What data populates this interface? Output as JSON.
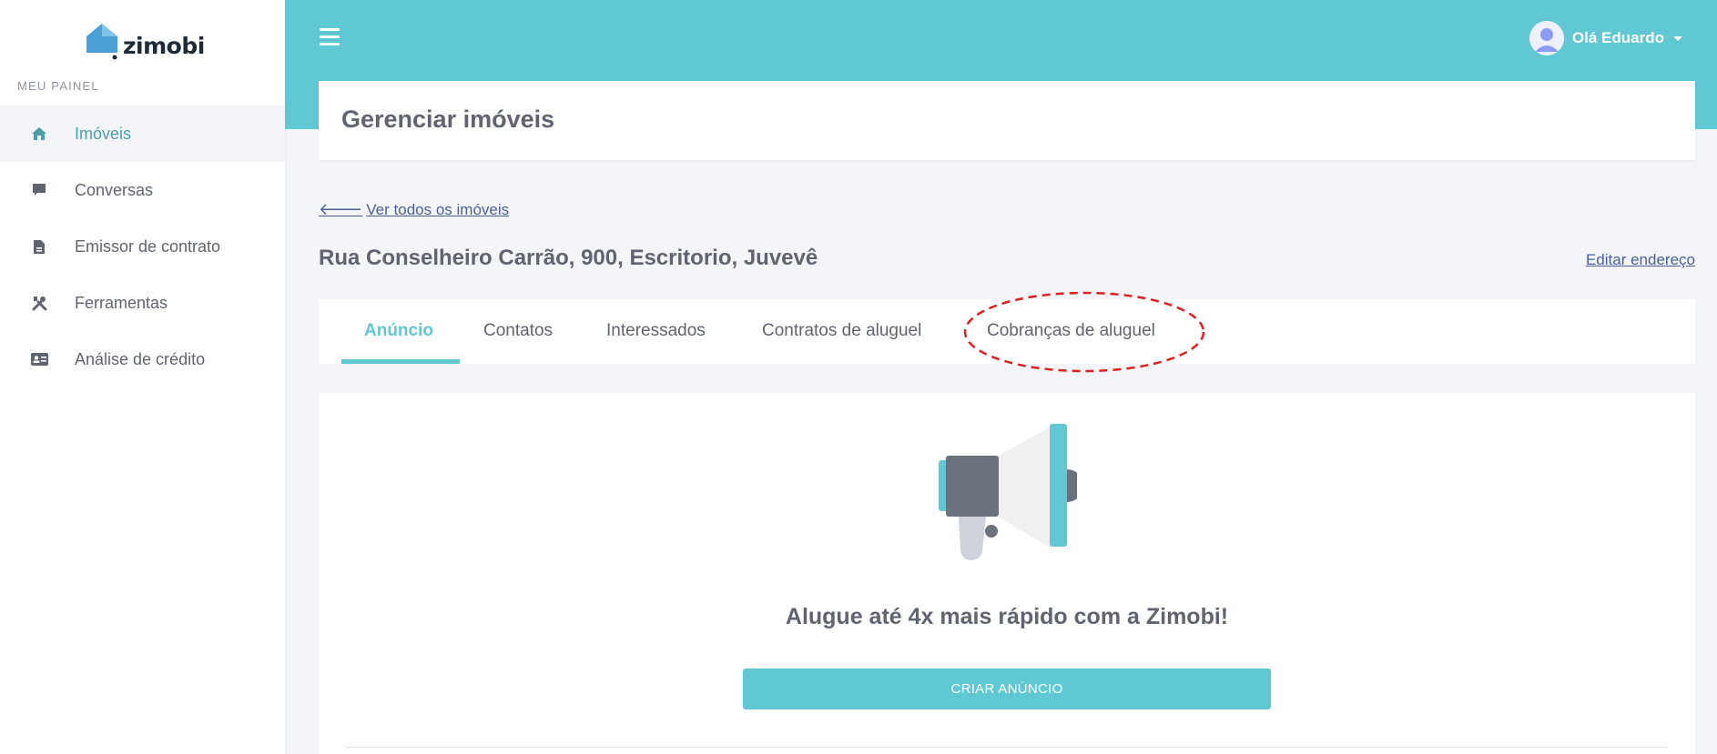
{
  "brand": {
    "name": "zimobi",
    "panel_label": "MEU PAINEL"
  },
  "sidebar": {
    "items": [
      {
        "label": "Imóveis",
        "icon": "home-icon",
        "active": true
      },
      {
        "label": "Conversas",
        "icon": "chat-icon",
        "active": false
      },
      {
        "label": "Emissor de contrato",
        "icon": "document-icon",
        "active": false
      },
      {
        "label": "Ferramentas",
        "icon": "tools-icon",
        "active": false
      },
      {
        "label": "Análise de crédito",
        "icon": "id-card-icon",
        "active": false
      }
    ]
  },
  "header": {
    "user_greeting": "Olá Eduardo"
  },
  "page": {
    "title": "Gerenciar imóveis",
    "back_link": "Ver todos os imóveis",
    "address": "Rua Conselheiro Carrão, 900, Escritorio, Juvevê",
    "edit_link": "Editar endereço"
  },
  "tabs": [
    {
      "label": "Anúncio",
      "active": true
    },
    {
      "label": "Contatos",
      "active": false
    },
    {
      "label": "Interessados",
      "active": false
    },
    {
      "label": "Contratos de aluguel",
      "active": false
    },
    {
      "label": "Cobranças de aluguel",
      "active": false,
      "highlighted": true
    }
  ],
  "main": {
    "promo_text": "Alugue até 4x mais rápido com a Zimobi!",
    "cta_label": "CRIAR ANÚNCIO"
  },
  "colors": {
    "accent": "#5fc8d3",
    "active_nav_text": "#4a9fab",
    "link": "#4a5fa0",
    "text": "#5f6470",
    "highlight": "#e02020"
  }
}
